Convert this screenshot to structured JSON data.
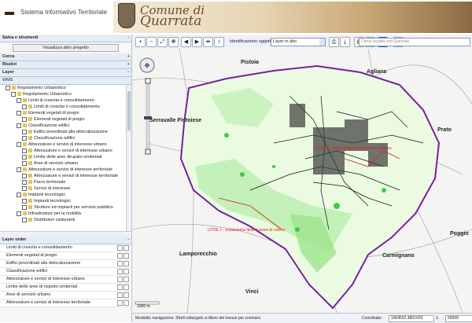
{
  "header": {
    "system_title": "Sistema Informativo Territoriale",
    "comune_line1": "Comune di",
    "comune_line2": "Quarrata"
  },
  "left_panel": {
    "sections": {
      "salva": "Salva e strumenti",
      "view_button": "Visualizza altro progetto",
      "cerca": "Cerca",
      "risolvi": "Risolvi",
      "layer": "Layer",
      "wms": "WMS"
    },
    "tree": [
      {
        "indent": 1,
        "label": "Regolamento Urbanistico"
      },
      {
        "indent": 2,
        "label": "Regolamento Urbanistico"
      },
      {
        "indent": 3,
        "label": "Limiti di crescita e consolidamento"
      },
      {
        "indent": 4,
        "label": "Limiti di crescita e consolidamento"
      },
      {
        "indent": 3,
        "label": "Elementi vegetali di pregio"
      },
      {
        "indent": 4,
        "label": "Elementi vegetali di pregio"
      },
      {
        "indent": 3,
        "label": "Classificazione edifici"
      },
      {
        "indent": 4,
        "label": "Edifici preordinati alla delocalizzazione"
      },
      {
        "indent": 4,
        "label": "Classificazione edifici"
      },
      {
        "indent": 3,
        "label": "Attrezzature e servizi di interesse urbano"
      },
      {
        "indent": 4,
        "label": "Attrezzature e servizi di interesse urbano"
      },
      {
        "indent": 4,
        "label": "Limite delle aree dirupato cimiteriali"
      },
      {
        "indent": 4,
        "label": "Aree di servizio urbano"
      },
      {
        "indent": 3,
        "label": "Attrezzature e servizi di interesse territoriale"
      },
      {
        "indent": 4,
        "label": "Attrezzature e servizi di interesse territoriale"
      },
      {
        "indent": 4,
        "label": "Parco territoriale"
      },
      {
        "indent": 4,
        "label": "Servizi di interesse"
      },
      {
        "indent": 3,
        "label": "Impianti tecnologici"
      },
      {
        "indent": 4,
        "label": "Impianti tecnologici"
      },
      {
        "indent": 4,
        "label": "Strutture ed impianti per servizio pubblico"
      },
      {
        "indent": 3,
        "label": "Infrastrutture per la mobilità"
      },
      {
        "indent": 4,
        "label": "Distributori carburanti"
      }
    ],
    "order_title": "Layer order",
    "order_items": [
      "Limiti di crescita e consolidamento",
      "Elementi vegetali di pregio",
      "Edifici preordinati alla delocalizzazione",
      "Classificazione edifici",
      "Attrezzature e servizi di interesse urbano",
      "Limite delle aree di rispetto cimiteriali",
      "Aree di servizio urbano",
      "Attrezzature e servizi di interesse territoriale"
    ]
  },
  "toolbar": {
    "identify_label": "Identificazione oggetti:",
    "identify_value": "Layer in alto",
    "search_placeholder": "Cerca località con Quarrata"
  },
  "map": {
    "places": [
      "Pistoia",
      "Agliana",
      "Serravalle Pistoiese",
      "Prato",
      "Lamporecchio",
      "Carmignano",
      "Poggio",
      "Vinci"
    ],
    "labels": [
      "UTOE 2 - subsistema della fascia di pianura",
      "UTOE 1 - subsistema delle frazioni di collina"
    ],
    "scalebar": "1000 m",
    "colors": {
      "boundary": "#7a1fa0",
      "green": "#36c23a",
      "roads": "#8c8c8c",
      "red": "#e02020"
    }
  },
  "status": {
    "mode": "Modalità: navigazione. Sfrafi rettangolo a rilievo del mouse per zoomare.",
    "coord_label": "Coordinate:",
    "coord_value": "1664552,4861603",
    "scale_label": "1:",
    "scale_value": "50000"
  }
}
